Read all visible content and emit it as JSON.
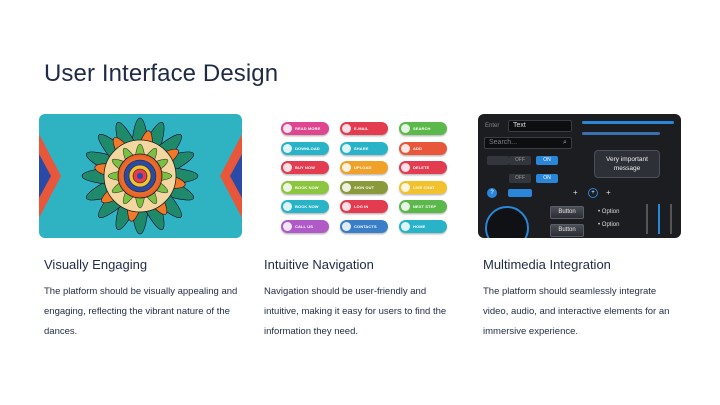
{
  "title": "User Interface Design",
  "colors": {
    "title": "#1f2a44",
    "text": "#1f2a44",
    "mandala_bg": "#2fb2c2",
    "mm_bg": "#1b1d21",
    "mm_accent": "#2a86d8"
  },
  "cards": [
    {
      "heading": "Visually Engaging",
      "description": "The platform should be visually appealing and engaging, reflecting the vibrant nature of the dances.",
      "image_icon": "mandala-illustration"
    },
    {
      "heading": "Intuitive Navigation",
      "description": "Navigation should be user-friendly and intuitive, making it easy for users to find the information they need.",
      "image_icon": "web-buttons-illustration"
    },
    {
      "heading": "Multimedia Integration",
      "description": "The platform should seamlessly integrate video, audio, and interactive elements for an immersive experience.",
      "image_icon": "dark-ui-kit-illustration"
    }
  ],
  "nav_buttons": [
    {
      "label": "READ MORE",
      "color": "#e0468f"
    },
    {
      "label": "E-MAIL",
      "color": "#e33b4f"
    },
    {
      "label": "SEARCH",
      "color": "#5bb84a"
    },
    {
      "label": "DOWNLOAD",
      "color": "#28b3c9"
    },
    {
      "label": "SHARE",
      "color": "#28b3c9"
    },
    {
      "label": "ADD",
      "color": "#e8573a"
    },
    {
      "label": "BUY NOW",
      "color": "#e33b4f"
    },
    {
      "label": "UPLOAD",
      "color": "#f0a12a"
    },
    {
      "label": "DELETE",
      "color": "#e33b4f"
    },
    {
      "label": "BOOK NOW",
      "color": "#8cc63f"
    },
    {
      "label": "SIGN OUT",
      "color": "#8a9a3a"
    },
    {
      "label": "LIVE CHAT",
      "color": "#f2c12e"
    },
    {
      "label": "BOOK NOW",
      "color": "#28b3c9"
    },
    {
      "label": "LOG IN",
      "color": "#e33b4f"
    },
    {
      "label": "NEXT STEP",
      "color": "#5bb84a"
    },
    {
      "label": "CALL US",
      "color": "#b05ac8"
    },
    {
      "label": "CONTACTS",
      "color": "#3a7ec8"
    },
    {
      "label": "HOME",
      "color": "#28b3c9"
    }
  ],
  "multimedia": {
    "enter_label": "Enter",
    "text_value": "Text",
    "search_placeholder": "Search...",
    "off_label": "OFF",
    "on_label": "ON",
    "bubble_text": "Very important message",
    "button_label": "Button",
    "option_label": "Option"
  }
}
